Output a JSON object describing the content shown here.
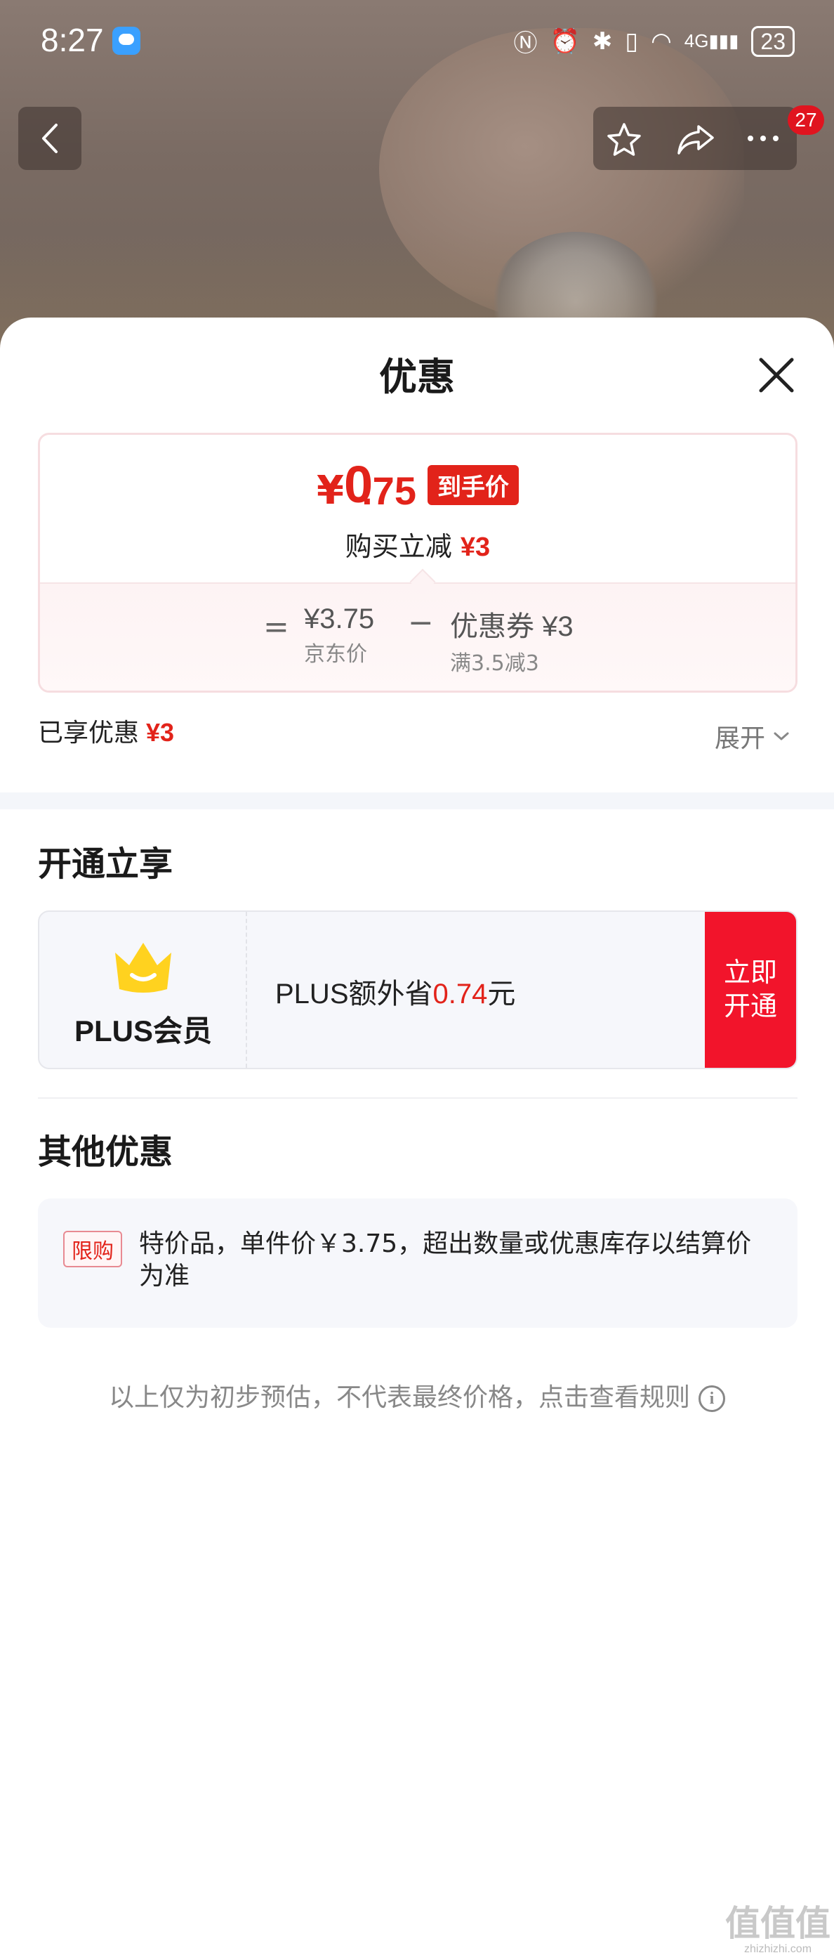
{
  "status_bar": {
    "time": "8:27",
    "network": "4G",
    "battery": "23"
  },
  "nav": {
    "cart_badge": "27"
  },
  "sheet": {
    "title": "优惠",
    "price_card": {
      "currency": "¥",
      "price_integer": "0",
      "price_decimal": ".75",
      "price_tag": "到手价",
      "instant_discount_label": "购买立减",
      "instant_discount_value": "¥3",
      "equals": "=",
      "jd_price_value": "¥3.75",
      "jd_price_label": "京东价",
      "minus": "−",
      "coupon_value": "优惠券 ¥3",
      "coupon_rule": "满3.5减3"
    },
    "applied": {
      "label": "已享优惠",
      "value": "¥3"
    },
    "expand_label": "展开",
    "membership": {
      "section_title": "开通立享",
      "plus_name": "PLUS会员",
      "desc_prefix": "PLUS额外省",
      "desc_amount": "0.74",
      "desc_suffix": "元",
      "open_line1": "立即",
      "open_line2": "开通"
    },
    "other_offers": {
      "section_title": "其他优惠",
      "limit_tag": "限购",
      "limit_text": "特价品，单件价￥3.75，超出数量或优惠库存以结算价为准"
    },
    "footnote": "以上仅为初步预估，不代表最终价格，点击查看规则",
    "footnote_icon": "i"
  },
  "watermark": {
    "main": "值值值",
    "sub": "zhizhizhi.com"
  },
  "colors": {
    "accent_red": "#e2231a",
    "open_button": "#f2142b",
    "crown_yellow": "#ffd21f"
  }
}
